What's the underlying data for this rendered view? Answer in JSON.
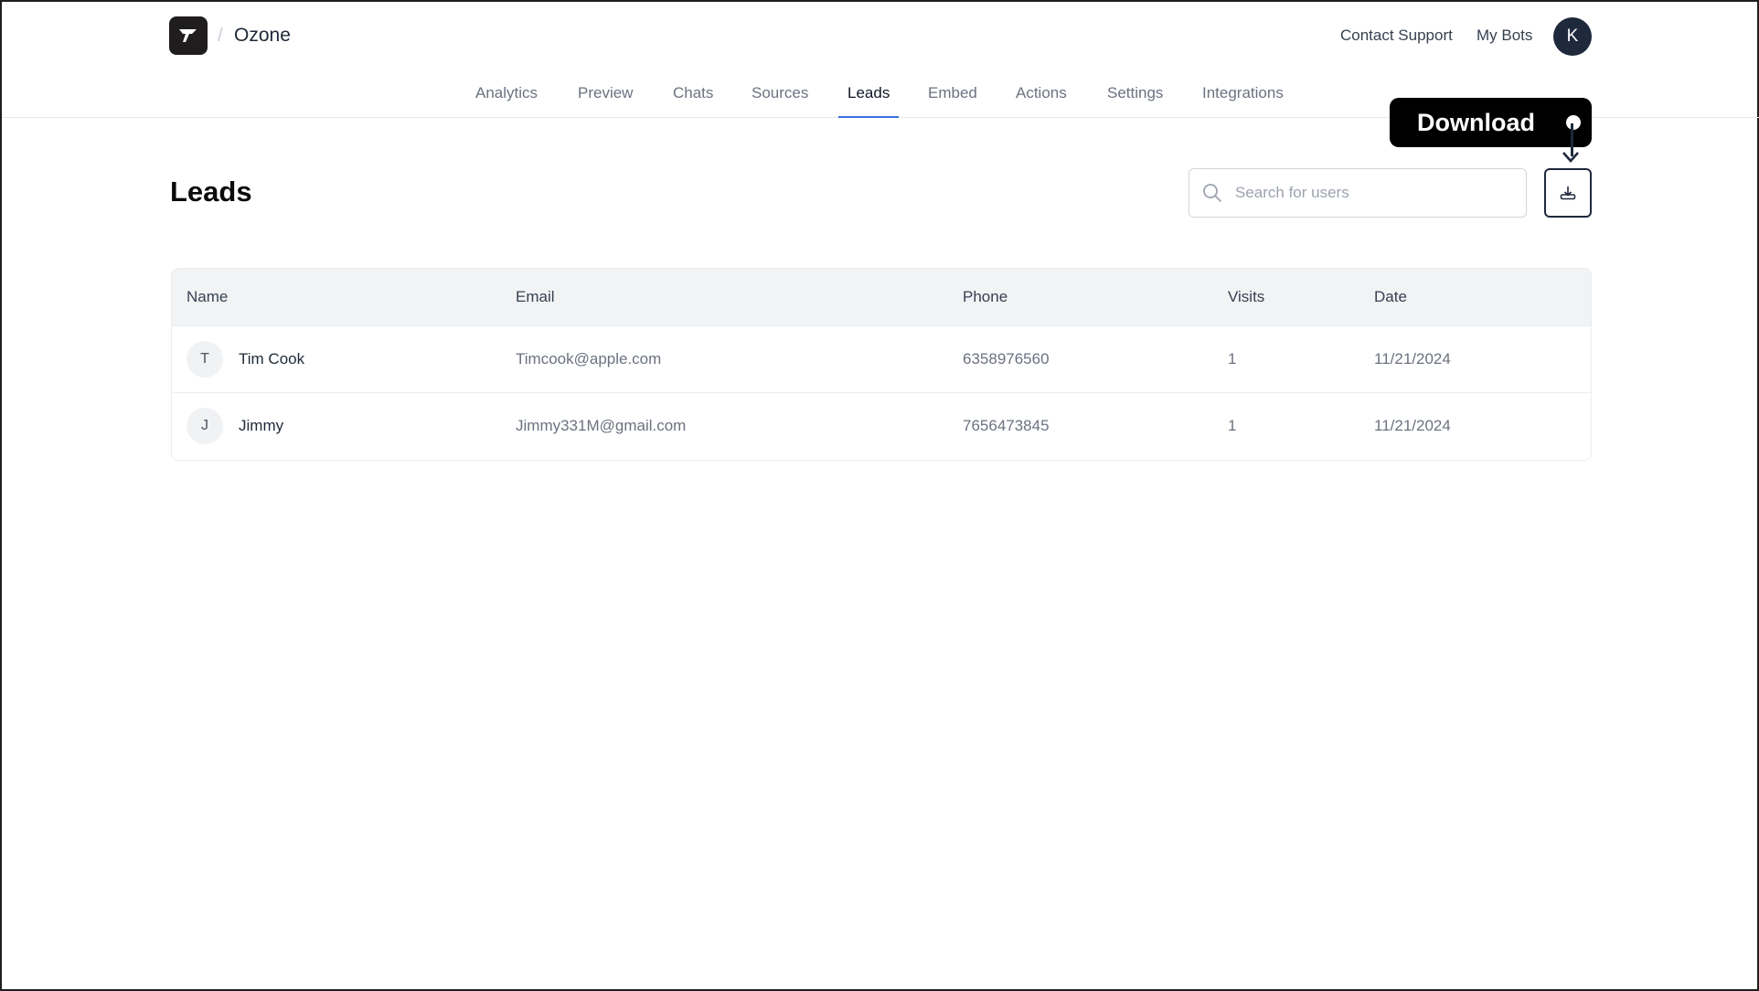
{
  "header": {
    "breadcrumb_separator": "/",
    "project_name": "Ozone",
    "links": {
      "contact_support": "Contact Support",
      "my_bots": "My Bots"
    },
    "avatar_initial": "K"
  },
  "nav": {
    "active": "Leads",
    "tabs": [
      {
        "label": "Analytics"
      },
      {
        "label": "Preview"
      },
      {
        "label": "Chats"
      },
      {
        "label": "Sources"
      },
      {
        "label": "Leads"
      },
      {
        "label": "Embed"
      },
      {
        "label": "Actions"
      },
      {
        "label": "Settings"
      },
      {
        "label": "Integrations"
      }
    ]
  },
  "page": {
    "title": "Leads",
    "search": {
      "placeholder": "Search for users",
      "value": ""
    },
    "download_icon": "download-icon"
  },
  "tooltip": {
    "label": "Download"
  },
  "table": {
    "columns": [
      "Name",
      "Email",
      "Phone",
      "Visits",
      "Date"
    ],
    "rows": [
      {
        "initial": "T",
        "name": "Tim Cook",
        "email": "Timcook@apple.com",
        "phone": "6358976560",
        "visits": "1",
        "date": "11/21/2024"
      },
      {
        "initial": "J",
        "name": "Jimmy",
        "email": "Jimmy331M@gmail.com",
        "phone": "7656473845",
        "visits": "1",
        "date": "11/21/2024"
      }
    ]
  },
  "colors": {
    "accent": "#3b6fe0",
    "avatar_bg": "#1e293b",
    "tooltip_bg": "#000000"
  }
}
